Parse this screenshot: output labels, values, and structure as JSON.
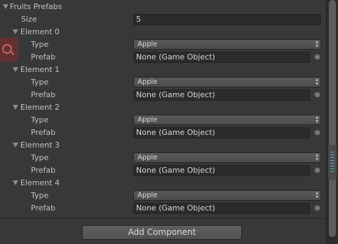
{
  "inspector": {
    "array_label": "Fruits Prefabs",
    "size_label": "Size",
    "size_value": "5",
    "type_label": "Type",
    "prefab_label": "Prefab",
    "elements": [
      {
        "label": "Element 0",
        "type_value": "Apple",
        "prefab_value": "None (Game Object)"
      },
      {
        "label": "Element 1",
        "type_value": "Apple",
        "prefab_value": "None (Game Object)"
      },
      {
        "label": "Element 2",
        "type_value": "Apple",
        "prefab_value": "None (Game Object)"
      },
      {
        "label": "Element 3",
        "type_value": "Apple",
        "prefab_value": "None (Game Object)"
      },
      {
        "label": "Element 4",
        "type_value": "Apple",
        "prefab_value": "None (Game Object)"
      }
    ],
    "add_component_label": "Add Component"
  },
  "icons": {
    "foldout": "triangle-down-icon",
    "search": "magnifier-icon",
    "object_picker": "object-picker-icon",
    "popup_arrows": "up-down-arrows-icon"
  },
  "colors": {
    "background": "#383838",
    "text": "#c2c2c2",
    "field": "#2b2b2b",
    "accent_overlay": "#962828",
    "scroll_grip": "#4fb6c4"
  }
}
